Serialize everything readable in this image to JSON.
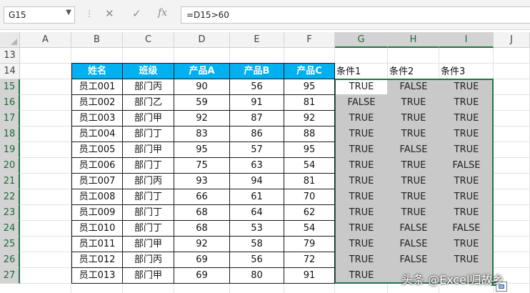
{
  "name_box": "G15",
  "formula": "=D15>60",
  "formula_buttons": {
    "cancel": "✕",
    "enter": "✓",
    "function": "fx"
  },
  "columns": [
    "A",
    "B",
    "C",
    "D",
    "E",
    "F",
    "G",
    "H",
    "I",
    "J"
  ],
  "rows": [
    "13",
    "14",
    "15",
    "16",
    "17",
    "18",
    "19",
    "20",
    "21",
    "22",
    "23",
    "24",
    "25",
    "26",
    "27"
  ],
  "table": {
    "headers": [
      "姓名",
      "班级",
      "产品A",
      "产品B",
      "产品C"
    ],
    "rows": [
      [
        "员工001",
        "部门丙",
        "90",
        "56",
        "95"
      ],
      [
        "员工002",
        "部门乙",
        "59",
        "91",
        "81"
      ],
      [
        "员工003",
        "部门甲",
        "92",
        "87",
        "92"
      ],
      [
        "员工004",
        "部门丁",
        "83",
        "86",
        "88"
      ],
      [
        "员工005",
        "部门甲",
        "95",
        "57",
        "95"
      ],
      [
        "员工006",
        "部门丁",
        "75",
        "63",
        "54"
      ],
      [
        "员工007",
        "部门丙",
        "93",
        "94",
        "81"
      ],
      [
        "员工008",
        "部门丁",
        "66",
        "61",
        "70"
      ],
      [
        "员工009",
        "部门丁",
        "68",
        "64",
        "62"
      ],
      [
        "员工010",
        "部门丁",
        "68",
        "53",
        "54"
      ],
      [
        "员工011",
        "部门甲",
        "92",
        "58",
        "79"
      ],
      [
        "员工012",
        "部门丙",
        "69",
        "56",
        "72"
      ],
      [
        "员工013",
        "部门甲",
        "69",
        "80",
        "91"
      ]
    ]
  },
  "conditions": {
    "headers": [
      "条件1",
      "条件2",
      "条件3"
    ],
    "rows": [
      [
        "TRUE",
        "FALSE",
        "TRUE"
      ],
      [
        "FALSE",
        "TRUE",
        "TRUE"
      ],
      [
        "TRUE",
        "TRUE",
        "TRUE"
      ],
      [
        "TRUE",
        "TRUE",
        "TRUE"
      ],
      [
        "TRUE",
        "FALSE",
        "TRUE"
      ],
      [
        "TRUE",
        "TRUE",
        "FALSE"
      ],
      [
        "TRUE",
        "TRUE",
        "TRUE"
      ],
      [
        "TRUE",
        "TRUE",
        "TRUE"
      ],
      [
        "TRUE",
        "TRUE",
        "TRUE"
      ],
      [
        "TRUE",
        "FALSE",
        "FALSE"
      ],
      [
        "TRUE",
        "FALSE",
        "TRUE"
      ],
      [
        "TRUE",
        "FALSE",
        "TRUE"
      ],
      [
        "TRUE",
        "",
        ""
      ]
    ]
  },
  "watermark": "头条 @Excel归故乡",
  "colors": {
    "header_fill": "#00b0f0",
    "selection_fill": "#c9c9c9",
    "selection_border": "#217346"
  }
}
